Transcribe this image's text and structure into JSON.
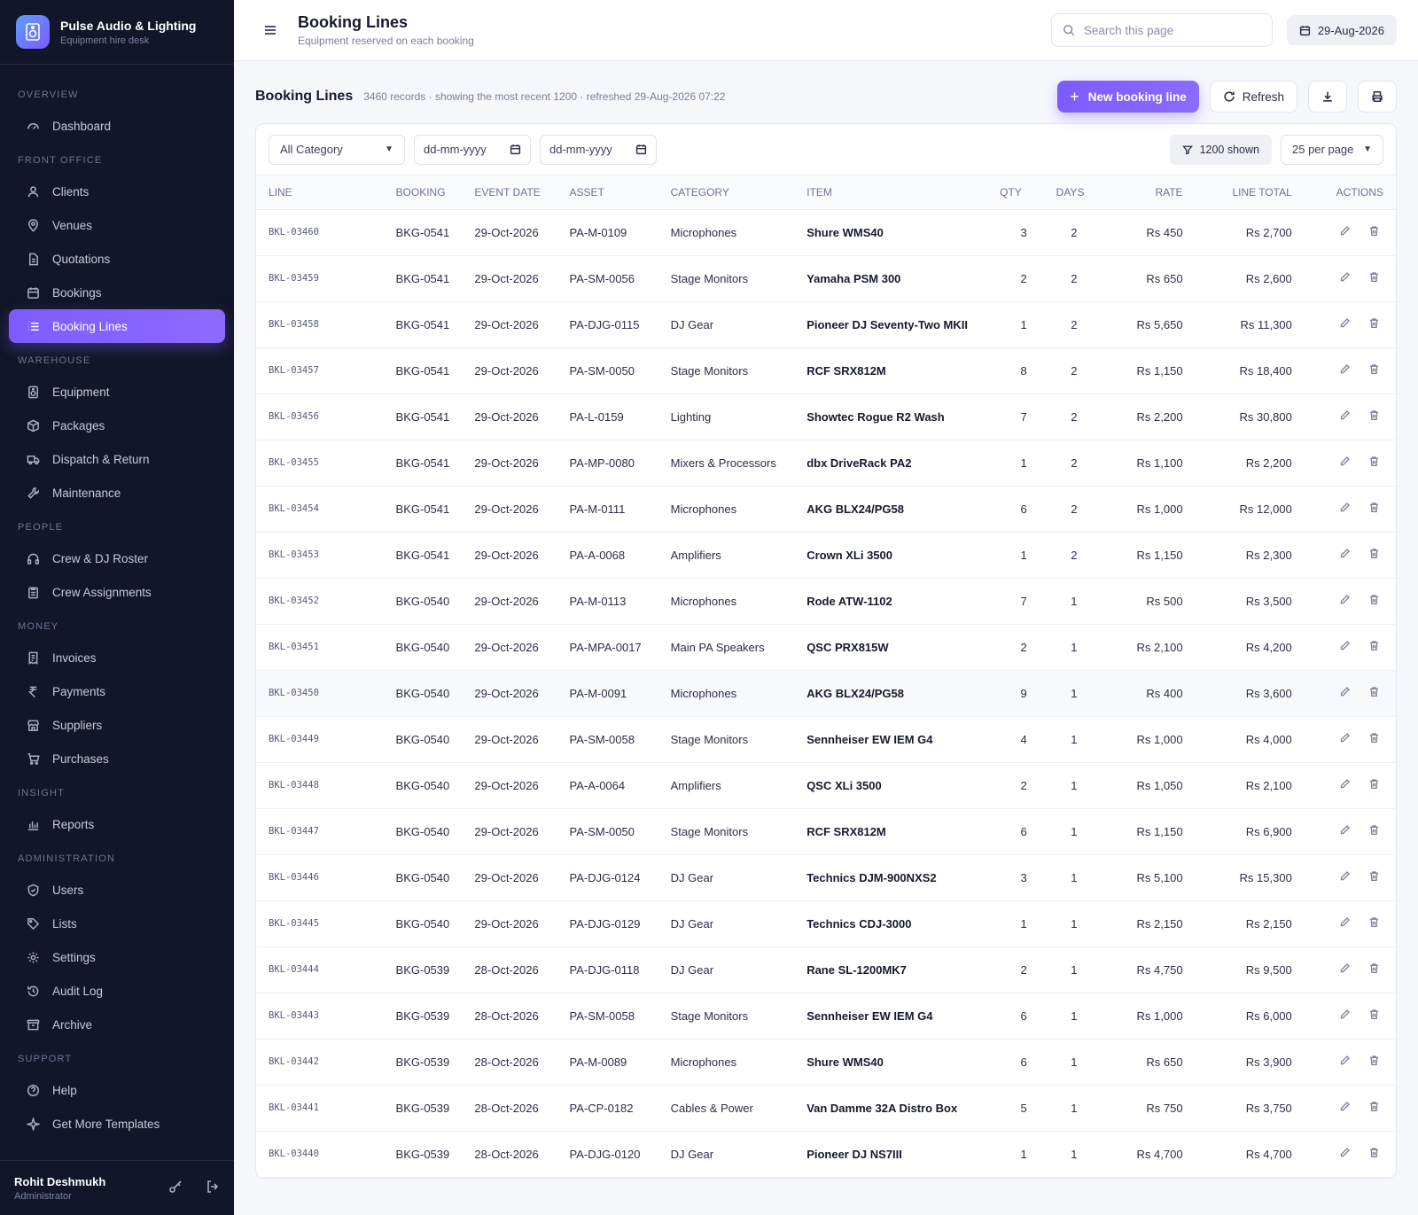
{
  "brand": {
    "title": "Pulse Audio & Lighting",
    "subtitle": "Equipment hire desk"
  },
  "nav": [
    {
      "section": "Overview",
      "items": [
        {
          "label": "Dashboard",
          "icon": "gauge-icon"
        }
      ]
    },
    {
      "section": "Front Office",
      "items": [
        {
          "label": "Clients",
          "icon": "users-icon"
        },
        {
          "label": "Venues",
          "icon": "map-pin-icon"
        },
        {
          "label": "Quotations",
          "icon": "file-icon"
        },
        {
          "label": "Bookings",
          "icon": "calendar-icon"
        },
        {
          "label": "Booking Lines",
          "icon": "list-icon",
          "active": true
        }
      ]
    },
    {
      "section": "Warehouse",
      "items": [
        {
          "label": "Equipment",
          "icon": "speaker-icon"
        },
        {
          "label": "Packages",
          "icon": "box-icon"
        },
        {
          "label": "Dispatch & Return",
          "icon": "truck-icon"
        },
        {
          "label": "Maintenance",
          "icon": "wrench-icon"
        }
      ]
    },
    {
      "section": "People",
      "items": [
        {
          "label": "Crew & DJ Roster",
          "icon": "headphones-icon"
        },
        {
          "label": "Crew Assignments",
          "icon": "clipboard-icon"
        }
      ]
    },
    {
      "section": "Money",
      "items": [
        {
          "label": "Invoices",
          "icon": "invoice-icon"
        },
        {
          "label": "Payments",
          "icon": "rupee-icon"
        },
        {
          "label": "Suppliers",
          "icon": "store-icon"
        },
        {
          "label": "Purchases",
          "icon": "cart-icon"
        }
      ]
    },
    {
      "section": "Insight",
      "items": [
        {
          "label": "Reports",
          "icon": "bar-chart-icon"
        }
      ]
    },
    {
      "section": "Administration",
      "items": [
        {
          "label": "Users",
          "icon": "shield-icon"
        },
        {
          "label": "Lists",
          "icon": "tag-icon"
        },
        {
          "label": "Settings",
          "icon": "gear-icon"
        },
        {
          "label": "Audit Log",
          "icon": "history-icon"
        },
        {
          "label": "Archive",
          "icon": "archive-icon"
        }
      ]
    },
    {
      "section": "Support",
      "items": [
        {
          "label": "Help",
          "icon": "help-icon"
        },
        {
          "label": "Get More Templates",
          "icon": "sparkle-icon"
        }
      ]
    }
  ],
  "user": {
    "name": "Rohit Deshmukh",
    "role": "Administrator"
  },
  "topbar": {
    "title": "Booking Lines",
    "subtitle": "Equipment reserved on each booking",
    "search_placeholder": "Search this page",
    "date": "29-Aug-2026"
  },
  "header": {
    "title": "Booking Lines",
    "meta": "3460 records · showing the most recent 1200 · refreshed 29-Aug-2026 07:22",
    "new_label": "New booking line",
    "refresh_label": "Refresh"
  },
  "filters": {
    "category": "All Category",
    "date_from": "dd-mm-yyyy",
    "date_to": "dd-mm-yyyy",
    "shown": "1200 shown",
    "per_page": "25 per page"
  },
  "columns": [
    "Line",
    "Booking",
    "Event Date",
    "Asset",
    "Category",
    "Item",
    "Qty",
    "Days",
    "Rate",
    "Line Total",
    "Actions"
  ],
  "rows": [
    [
      "BKL-03460",
      "BKG-0541",
      "29-Oct-2026",
      "PA-M-0109",
      "Microphones",
      "Shure WMS40",
      "3",
      "2",
      "Rs 450",
      "Rs 2,700"
    ],
    [
      "BKL-03459",
      "BKG-0541",
      "29-Oct-2026",
      "PA-SM-0056",
      "Stage Monitors",
      "Yamaha PSM 300",
      "2",
      "2",
      "Rs 650",
      "Rs 2,600"
    ],
    [
      "BKL-03458",
      "BKG-0541",
      "29-Oct-2026",
      "PA-DJG-0115",
      "DJ Gear",
      "Pioneer DJ Seventy-Two MKII",
      "1",
      "2",
      "Rs 5,650",
      "Rs 11,300"
    ],
    [
      "BKL-03457",
      "BKG-0541",
      "29-Oct-2026",
      "PA-SM-0050",
      "Stage Monitors",
      "RCF SRX812M",
      "8",
      "2",
      "Rs 1,150",
      "Rs 18,400"
    ],
    [
      "BKL-03456",
      "BKG-0541",
      "29-Oct-2026",
      "PA-L-0159",
      "Lighting",
      "Showtec Rogue R2 Wash",
      "7",
      "2",
      "Rs 2,200",
      "Rs 30,800"
    ],
    [
      "BKL-03455",
      "BKG-0541",
      "29-Oct-2026",
      "PA-MP-0080",
      "Mixers & Processors",
      "dbx DriveRack PA2",
      "1",
      "2",
      "Rs 1,100",
      "Rs 2,200"
    ],
    [
      "BKL-03454",
      "BKG-0541",
      "29-Oct-2026",
      "PA-M-0111",
      "Microphones",
      "AKG BLX24/PG58",
      "6",
      "2",
      "Rs 1,000",
      "Rs 12,000"
    ],
    [
      "BKL-03453",
      "BKG-0541",
      "29-Oct-2026",
      "PA-A-0068",
      "Amplifiers",
      "Crown XLi 3500",
      "1",
      "2",
      "Rs 1,150",
      "Rs 2,300"
    ],
    [
      "BKL-03452",
      "BKG-0540",
      "29-Oct-2026",
      "PA-M-0113",
      "Microphones",
      "Rode ATW-1102",
      "7",
      "1",
      "Rs 500",
      "Rs 3,500"
    ],
    [
      "BKL-03451",
      "BKG-0540",
      "29-Oct-2026",
      "PA-MPA-0017",
      "Main PA Speakers",
      "QSC PRX815W",
      "2",
      "1",
      "Rs 2,100",
      "Rs 4,200"
    ],
    [
      "BKL-03450",
      "BKG-0540",
      "29-Oct-2026",
      "PA-M-0091",
      "Microphones",
      "AKG BLX24/PG58",
      "9",
      "1",
      "Rs 400",
      "Rs 3,600"
    ],
    [
      "BKL-03449",
      "BKG-0540",
      "29-Oct-2026",
      "PA-SM-0058",
      "Stage Monitors",
      "Sennheiser EW IEM G4",
      "4",
      "1",
      "Rs 1,000",
      "Rs 4,000"
    ],
    [
      "BKL-03448",
      "BKG-0540",
      "29-Oct-2026",
      "PA-A-0064",
      "Amplifiers",
      "QSC XLi 3500",
      "2",
      "1",
      "Rs 1,050",
      "Rs 2,100"
    ],
    [
      "BKL-03447",
      "BKG-0540",
      "29-Oct-2026",
      "PA-SM-0050",
      "Stage Monitors",
      "RCF SRX812M",
      "6",
      "1",
      "Rs 1,150",
      "Rs 6,900"
    ],
    [
      "BKL-03446",
      "BKG-0540",
      "29-Oct-2026",
      "PA-DJG-0124",
      "DJ Gear",
      "Technics DJM-900NXS2",
      "3",
      "1",
      "Rs 5,100",
      "Rs 15,300"
    ],
    [
      "BKL-03445",
      "BKG-0540",
      "29-Oct-2026",
      "PA-DJG-0129",
      "DJ Gear",
      "Technics CDJ-3000",
      "1",
      "1",
      "Rs 2,150",
      "Rs 2,150"
    ],
    [
      "BKL-03444",
      "BKG-0539",
      "28-Oct-2026",
      "PA-DJG-0118",
      "DJ Gear",
      "Rane SL-1200MK7",
      "2",
      "1",
      "Rs 4,750",
      "Rs 9,500"
    ],
    [
      "BKL-03443",
      "BKG-0539",
      "28-Oct-2026",
      "PA-SM-0058",
      "Stage Monitors",
      "Sennheiser EW IEM G4",
      "6",
      "1",
      "Rs 1,000",
      "Rs 6,000"
    ],
    [
      "BKL-03442",
      "BKG-0539",
      "28-Oct-2026",
      "PA-M-0089",
      "Microphones",
      "Shure WMS40",
      "6",
      "1",
      "Rs 650",
      "Rs 3,900"
    ],
    [
      "BKL-03441",
      "BKG-0539",
      "28-Oct-2026",
      "PA-CP-0182",
      "Cables & Power",
      "Van Damme 32A Distro Box",
      "5",
      "1",
      "Rs 750",
      "Rs 3,750"
    ],
    [
      "BKL-03440",
      "BKG-0539",
      "28-Oct-2026",
      "PA-DJG-0120",
      "DJ Gear",
      "Pioneer DJ NS7III",
      "1",
      "1",
      "Rs 4,700",
      "Rs 4,700"
    ]
  ],
  "highlight_row": 10,
  "colors": {
    "accent": "#7c5cff",
    "sidebar_bg": "#121628"
  }
}
